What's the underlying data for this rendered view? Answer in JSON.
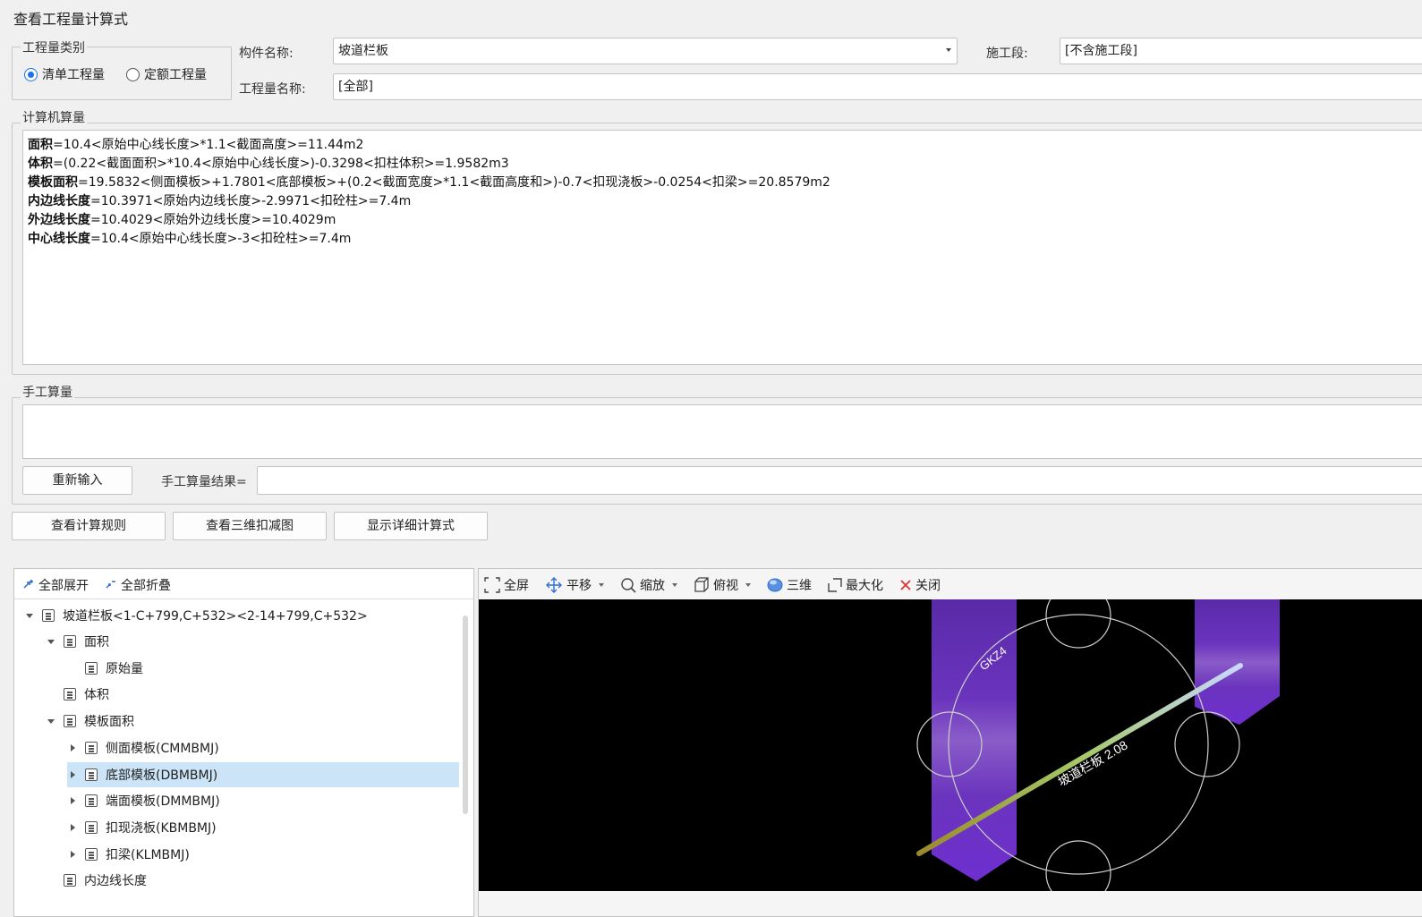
{
  "window": {
    "title": "查看工程量计算式"
  },
  "category": {
    "legend": "工程量类别",
    "options": [
      {
        "label": "清单工程量",
        "checked": true
      },
      {
        "label": "定额工程量",
        "checked": false
      }
    ]
  },
  "component": {
    "label": "构件名称:",
    "value": "坡道栏板"
  },
  "stage": {
    "label": "施工段:",
    "value": "[不含施工段]"
  },
  "quantity_name": {
    "label": "工程量名称:",
    "value": "[全部]"
  },
  "computer": {
    "legend": "计算机算量",
    "lines": [
      {
        "name": "面积",
        "expr": "=10.4<原始中心线长度>*1.1<截面高度>=11.44m2"
      },
      {
        "name": "体积",
        "expr": "=(0.22<截面面积>*10.4<原始中心线长度>)-0.3298<扣柱体积>=1.9582m3"
      },
      {
        "name": "模板面积",
        "expr": "=19.5832<侧面模板>+1.7801<底部模板>+(0.2<截面宽度>*1.1<截面高度和>)-0.7<扣现浇板>-0.0254<扣梁>=20.8579m2"
      },
      {
        "name": "内边线长度",
        "expr": "=10.3971<原始内边线长度>-2.9971<扣砼柱>=7.4m"
      },
      {
        "name": "外边线长度",
        "expr": "=10.4029<原始外边线长度>=10.4029m"
      },
      {
        "name": "中心线长度",
        "expr": "=10.4<原始中心线长度>-3<扣砼柱>=7.4m"
      }
    ]
  },
  "manual": {
    "legend": "手工算量",
    "reinput": "重新输入",
    "result_label": "手工算量结果=",
    "result_value": ""
  },
  "buttons": {
    "rules": "查看计算规则",
    "deduct3d": "查看三维扣减图",
    "detail": "显示详细计算式"
  },
  "tree_toolbar": {
    "expand_all": "全部展开",
    "collapse_all": "全部折叠"
  },
  "tree": {
    "root": "坡道栏板<1-C+799,C+532><2-14+799,C+532>",
    "area": "面积",
    "area_raw": "原始量",
    "volume": "体积",
    "formwork": "模板面积",
    "side": "侧面模板(CMMBMJ)",
    "bottom": "底部模板(DBMBMJ)",
    "end": "端面模板(DMMBMJ)",
    "slab": "扣现浇板(KBMBMJ)",
    "beam": "扣梁(KLMBMJ)",
    "inner": "内边线长度"
  },
  "view_toolbar": {
    "fullscreen": "全屏",
    "pan": "平移",
    "zoom": "缩放",
    "top": "俯视",
    "three_d": "三维",
    "maximize": "最大化",
    "close": "关闭"
  },
  "view": {
    "column_label": "GKZ4",
    "slab_label": "坡道栏板 2.08",
    "bg_color": "#000000",
    "column_color": "#6a2fc0",
    "slab_color": "#a8d060"
  }
}
